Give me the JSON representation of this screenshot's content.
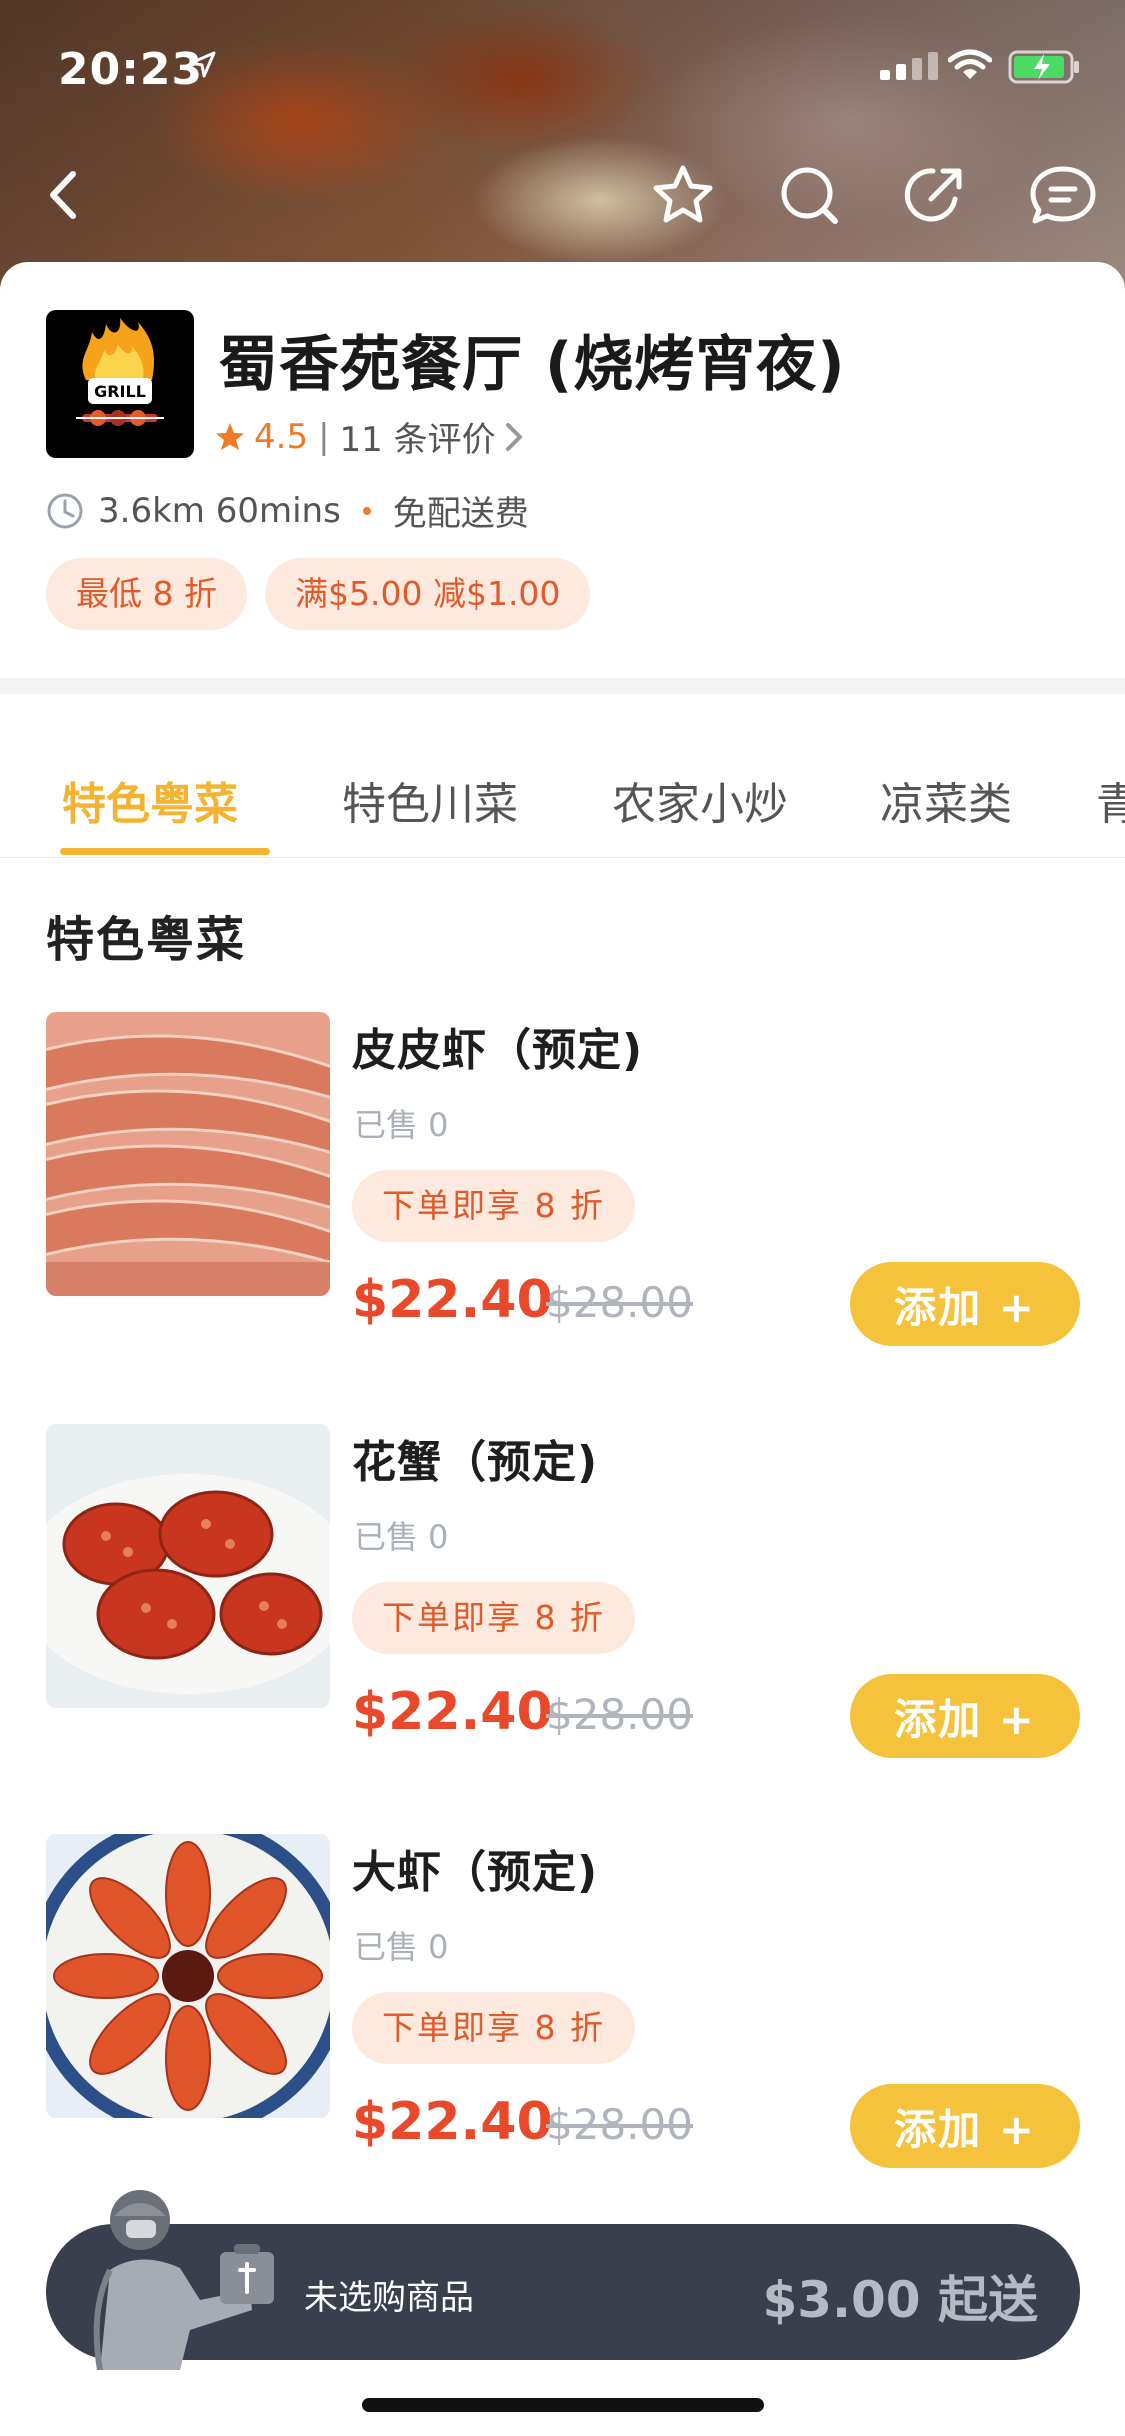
{
  "status_bar": {
    "time": "20:23"
  },
  "restaurant": {
    "logo_text": "GRILL",
    "name": "蜀香苑餐厅 (烧烤宵夜)",
    "rating": "4.5",
    "separator": "|",
    "reviews": "11 条评价",
    "distance_time": "3.6km 60mins",
    "delivery": "免配送费",
    "tags": [
      "最低 8 折",
      "满$5.00 减$1.00"
    ]
  },
  "tabs": [
    {
      "label": "特色粤菜",
      "active": true
    },
    {
      "label": "特色川菜",
      "active": false
    },
    {
      "label": "农家小炒",
      "active": false
    },
    {
      "label": "凉菜类",
      "active": false
    },
    {
      "label": "青",
      "active": false
    }
  ],
  "section": {
    "title": "特色粤菜"
  },
  "items": [
    {
      "name": "皮皮虾（预定)",
      "sold": "已售 0",
      "promo": "下单即享 8 折",
      "price": "$22.40",
      "original_price": "$28.00",
      "add_label": "添加 +"
    },
    {
      "name": "花蟹（预定)",
      "sold": "已售 0",
      "promo": "下单即享 8 折",
      "price": "$22.40",
      "original_price": "$28.00",
      "add_label": "添加 +"
    },
    {
      "name": "大虾（预定)",
      "sold": "已售 0",
      "promo": "下单即享 8 折",
      "price": "$22.40",
      "original_price": "$28.00",
      "add_label": "添加 +"
    }
  ],
  "cart": {
    "empty_text": "未选购商品",
    "min_order": "$3.00 起送"
  },
  "colors": {
    "accent_yellow": "#f5c33b",
    "price_red": "#e8492a",
    "promo_bg": "#fde9dd",
    "cart_bg": "#3a3f4d"
  },
  "icons": [
    "back-icon",
    "star-icon",
    "search-icon",
    "share-icon",
    "message-icon",
    "clock-icon",
    "rating-star-icon",
    "chevron-right-icon"
  ]
}
